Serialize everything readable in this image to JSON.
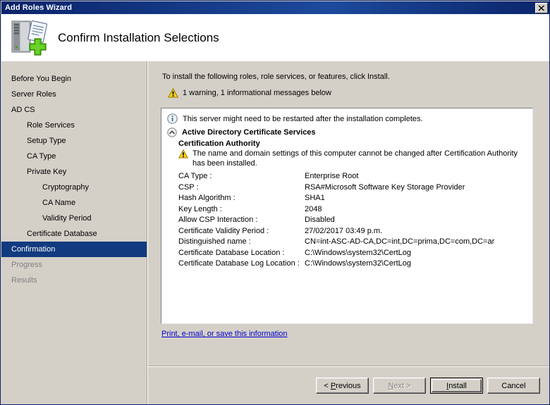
{
  "window": {
    "title": "Add Roles Wizard",
    "close_label": "x"
  },
  "header": {
    "title": "Confirm Installation Selections",
    "icon": "server-add-icon"
  },
  "sidebar": {
    "items": [
      {
        "label": "Before You Begin",
        "level": 0,
        "state": "normal"
      },
      {
        "label": "Server Roles",
        "level": 0,
        "state": "normal"
      },
      {
        "label": "AD CS",
        "level": 0,
        "state": "normal"
      },
      {
        "label": "Role Services",
        "level": 1,
        "state": "normal"
      },
      {
        "label": "Setup Type",
        "level": 1,
        "state": "normal"
      },
      {
        "label": "CA Type",
        "level": 1,
        "state": "normal"
      },
      {
        "label": "Private Key",
        "level": 1,
        "state": "normal"
      },
      {
        "label": "Cryptography",
        "level": 2,
        "state": "normal"
      },
      {
        "label": "CA Name",
        "level": 2,
        "state": "normal"
      },
      {
        "label": "Validity Period",
        "level": 2,
        "state": "normal"
      },
      {
        "label": "Certificate Database",
        "level": 1,
        "state": "normal"
      },
      {
        "label": "Confirmation",
        "level": 0,
        "state": "selected"
      },
      {
        "label": "Progress",
        "level": 0,
        "state": "disabled"
      },
      {
        "label": "Results",
        "level": 0,
        "state": "disabled"
      }
    ]
  },
  "content": {
    "intro": "To install the following roles, role services, or features, click Install.",
    "warning_summary": "1 warning, 1 informational messages below",
    "warning_icon": "warning-triangle-icon",
    "restart_icon": "info-circle-icon",
    "restart_message": "This server might need to be restarted after the installation completes.",
    "collapse_icon": "chevron-up-circle-icon",
    "section_title": "Active Directory Certificate Services",
    "sub_title": "Certification Authority",
    "sub_warning_icon": "warning-triangle-icon",
    "sub_warning_message": "The name and domain settings of this computer cannot be changed after Certification Authority has been installed.",
    "details": [
      {
        "label": "CA Type :",
        "value": "Enterprise Root"
      },
      {
        "label": "CSP :",
        "value": "RSA#Microsoft Software Key Storage Provider"
      },
      {
        "label": "Hash Algorithm :",
        "value": "SHA1"
      },
      {
        "label": "Key Length :",
        "value": "2048"
      },
      {
        "label": "Allow CSP Interaction :",
        "value": "Disabled"
      },
      {
        "label": "Certificate Validity Period :",
        "value": "27/02/2017 03:49 p.m."
      },
      {
        "label": "Distinguished name :",
        "value": "CN=int-ASC-AD-CA,DC=int,DC=prima,DC=com,DC=ar"
      },
      {
        "label": "Certificate Database Location :",
        "value": "C:\\Windows\\system32\\CertLog"
      },
      {
        "label": "Certificate Database Log Location :",
        "value": "C:\\Windows\\system32\\CertLog"
      }
    ],
    "print_link": "Print, e-mail, or save this information"
  },
  "footer": {
    "previous": {
      "pre": "< ",
      "mnemonic": "P",
      "post": "revious"
    },
    "next": {
      "pre": "",
      "mnemonic": "N",
      "post": "ext >"
    },
    "install": {
      "pre": "",
      "mnemonic": "I",
      "post": "nstall"
    },
    "cancel": {
      "pre": "",
      "mnemonic": "",
      "post": "Cancel"
    }
  },
  "colors": {
    "titlebar": "#0a246a",
    "selection": "#113a7f",
    "face": "#d4d0c8",
    "link": "#0000cc",
    "warning": "#f5c518"
  }
}
